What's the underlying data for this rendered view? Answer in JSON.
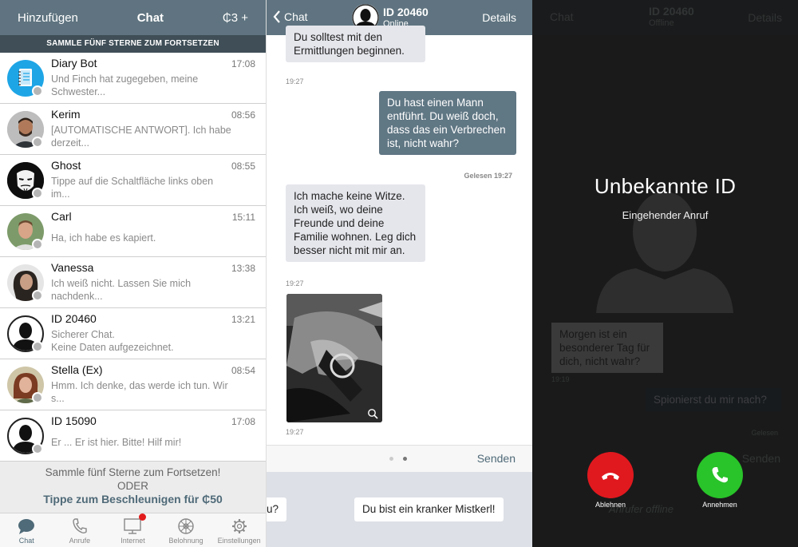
{
  "list": {
    "header": {
      "add_label": "Hinzufügen",
      "title": "Chat",
      "coins": "₵3 +"
    },
    "banner": "SAMMLE FÜNF STERNE ZUM FORTSETZEN",
    "items": [
      {
        "name": "Diary Bot",
        "time": "17:08",
        "preview": "Und Finch hat zugegeben, meine Schwester..."
      },
      {
        "name": "Kerim",
        "time": "08:56",
        "preview": "[AUTOMATISCHE ANTWORT]. Ich habe derzeit..."
      },
      {
        "name": "Ghost",
        "time": "08:55",
        "preview": "Tippe auf die Schaltfläche links oben im..."
      },
      {
        "name": "Carl",
        "time": "15:11",
        "preview": "Ha, ich habe es kapiert."
      },
      {
        "name": "Vanessa",
        "time": "13:38",
        "preview": "Ich weiß nicht. Lassen Sie mich nachdenk..."
      },
      {
        "name": "ID 20460",
        "time": "13:21",
        "preview": "Sicherer Chat.\nKeine Daten aufgezeichnet."
      },
      {
        "name": "Stella (Ex)",
        "time": "08:54",
        "preview": "Hmm. Ich denke, das werde ich tun. Wir s..."
      },
      {
        "name": "ID 15090",
        "time": "17:08",
        "preview": "Er ... Er ist hier. Bitte! Hilf mir!"
      }
    ],
    "promo": {
      "line1": "Sammle fünf Sterne zum Fortsetzen!",
      "line2": "ODER",
      "tip": "Tippe zum Beschleunigen für ₵50"
    },
    "tabs": [
      "Chat",
      "Anrufe",
      "Internet",
      "Belohnung",
      "Einstellungen"
    ]
  },
  "conversation": {
    "back_label": "Chat",
    "contact_name": "ID 20460",
    "contact_status": "Online",
    "details_label": "Details",
    "messages": [
      {
        "text": "Du solltest mit den Ermittlungen beginnen.",
        "time": "19:27"
      },
      {
        "text": "Du hast einen Mann entführt. Du weiß doch, dass das ein Verbrechen ist, nicht wahr?",
        "time": "Gelesen 19:27"
      },
      {
        "text": "Ich mache keine Witze. Ich weiß, wo deine Freunde und deine Familie wohnen. Leg dich besser nicht mit mir an.",
        "time": "19:27"
      },
      {
        "time": "19:27"
      }
    ],
    "send_label": "Senden",
    "replies": [
      "u?",
      "Du bist ein kranker Mistkerl!"
    ]
  },
  "call": {
    "ghost": {
      "back_label": "Chat",
      "name": "ID 20460",
      "status": "Offline",
      "details_label": "Details",
      "msg_in": "Morgen ist ein besonderer Tag für dich, nicht wahr?",
      "msg_in_time": "19:19",
      "msg_out": "Spionierst du mir nach?",
      "msg_out_time": "Gelesen",
      "send_label": "Senden",
      "footer": "Anrufer offline"
    },
    "title": "Unbekannte ID",
    "subtitle": "Eingehender Anruf",
    "decline_label": "Ablehnen",
    "accept_label": "Annehmen"
  },
  "colors": {
    "header": "#5f7480",
    "banner": "#3f4e57",
    "decline": "#e0191f",
    "accept": "#29c32a",
    "outgoing": "#607784"
  }
}
